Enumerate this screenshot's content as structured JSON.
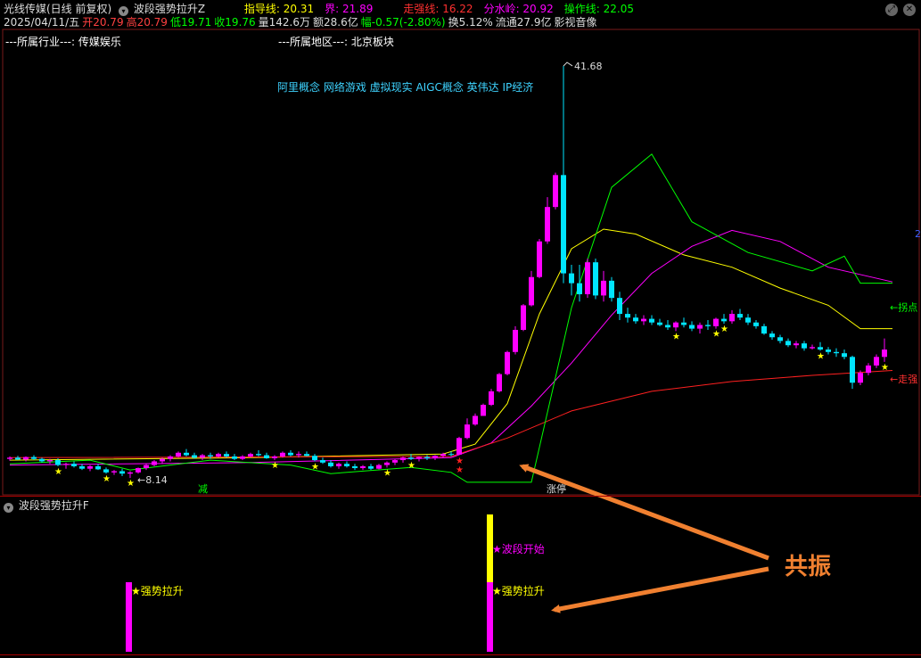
{
  "header": {
    "stock_name": "光线传媒(日线 前复权)",
    "indicator_name": "波段强势拉升Z",
    "params": [
      {
        "label": "指导线: 20.31",
        "color": "#ffff00"
      },
      {
        "label": "界: 21.89",
        "color": "#ff00ff"
      },
      {
        "label": "走强线: 16.22",
        "color": "#ff3030"
      },
      {
        "label": "分水岭: 20.92",
        "color": "#ff00ff"
      },
      {
        "label": "操作线: 22.05",
        "color": "#00ff00"
      }
    ],
    "quote": [
      {
        "label": "2025/04/11/五",
        "color": "#dddddd"
      },
      {
        "label": "开20.79",
        "color": "#ff4040"
      },
      {
        "label": "高20.79",
        "color": "#ff4040"
      },
      {
        "label": "低19.71",
        "color": "#00ff00"
      },
      {
        "label": "收19.76",
        "color": "#00ff00"
      },
      {
        "label": "量142.6万",
        "color": "#dddddd"
      },
      {
        "label": "额28.6亿",
        "color": "#dddddd"
      },
      {
        "label": "幅-0.57(-2.80%)",
        "color": "#00ff00"
      },
      {
        "label": "换5.12%",
        "color": "#dddddd"
      },
      {
        "label": "流通27.9亿",
        "color": "#dddddd"
      },
      {
        "label": "影视音像",
        "color": "#dddddd"
      }
    ]
  },
  "info": {
    "industry": "---所属行业---: 传媒娱乐",
    "region": "---所属地区---: 北京板块",
    "concepts": "阿里概念 网络游戏 虚拟现实 AIGC概念 英伟达 IP经济"
  },
  "sub_panel": {
    "title": "波段强势拉升F"
  },
  "annotation": {
    "resonance": "共振"
  },
  "colors": {
    "bull_candle": "#ff00ff",
    "bear_candle": "#00e5ff",
    "guide_line": "#ffff00",
    "watershed_line": "#ff00ff",
    "strong_line": "#ff2020",
    "operation_line": "#00ff00",
    "arrow": "#f08030"
  },
  "chart_data": [
    {
      "type": "candlestick",
      "title": "光线传媒(日线 前复权)",
      "price_range": [
        7.5,
        44.0
      ],
      "annotations": {
        "high_label": "41.68",
        "low_label": "8.14",
        "right_labels": [
          "←拐点",
          "←走强"
        ],
        "bottom_marks": [
          "减",
          "涨停"
        ],
        "side_number": "2"
      },
      "candles_ohlc": [
        [
          9.7,
          9.9,
          9.55,
          9.8
        ],
        [
          9.8,
          9.95,
          9.6,
          9.65
        ],
        [
          9.65,
          9.9,
          9.5,
          9.85
        ],
        [
          9.85,
          10.0,
          9.6,
          9.7
        ],
        [
          9.7,
          9.8,
          9.4,
          9.5
        ],
        [
          9.5,
          9.7,
          9.3,
          9.6
        ],
        [
          9.6,
          9.75,
          9.1,
          9.2
        ],
        [
          9.2,
          9.4,
          8.9,
          9.3
        ],
        [
          9.3,
          9.5,
          9.0,
          9.1
        ],
        [
          9.1,
          9.3,
          8.8,
          8.9
        ],
        [
          8.9,
          9.2,
          8.7,
          9.1
        ],
        [
          9.1,
          9.3,
          8.8,
          8.85
        ],
        [
          8.85,
          9.0,
          8.5,
          8.6
        ],
        [
          8.6,
          8.8,
          8.4,
          8.7
        ],
        [
          8.7,
          8.9,
          8.3,
          8.5
        ],
        [
          8.5,
          8.7,
          8.14,
          8.6
        ],
        [
          8.6,
          9.0,
          8.5,
          8.95
        ],
        [
          8.95,
          9.3,
          8.8,
          9.2
        ],
        [
          9.2,
          9.6,
          9.1,
          9.5
        ],
        [
          9.5,
          9.8,
          9.3,
          9.7
        ],
        [
          9.7,
          10.0,
          9.5,
          9.9
        ],
        [
          9.9,
          10.3,
          9.8,
          10.2
        ],
        [
          10.2,
          10.5,
          9.9,
          10.0
        ],
        [
          10.0,
          10.2,
          9.7,
          9.8
        ],
        [
          9.8,
          10.1,
          9.6,
          10.0
        ],
        [
          10.0,
          10.2,
          9.7,
          9.9
        ],
        [
          9.9,
          10.2,
          9.8,
          10.1
        ],
        [
          10.1,
          10.3,
          9.8,
          9.9
        ],
        [
          9.9,
          10.1,
          9.6,
          9.7
        ],
        [
          9.7,
          10.0,
          9.6,
          9.9
        ],
        [
          9.9,
          10.2,
          9.8,
          10.1
        ],
        [
          10.1,
          10.4,
          9.9,
          10.0
        ],
        [
          10.0,
          10.2,
          9.7,
          9.75
        ],
        [
          9.75,
          10.0,
          9.6,
          9.9
        ],
        [
          9.9,
          10.3,
          9.8,
          10.2
        ],
        [
          10.2,
          10.4,
          9.9,
          10.0
        ],
        [
          10.0,
          10.3,
          9.8,
          10.1
        ],
        [
          10.1,
          10.3,
          9.9,
          9.95
        ],
        [
          9.95,
          10.1,
          9.5,
          9.6
        ],
        [
          9.6,
          9.8,
          9.3,
          9.4
        ],
        [
          9.4,
          9.6,
          9.0,
          9.1
        ],
        [
          9.1,
          9.4,
          8.9,
          9.3
        ],
        [
          9.3,
          9.5,
          9.0,
          9.1
        ],
        [
          9.1,
          9.3,
          8.8,
          8.95
        ],
        [
          8.95,
          9.2,
          8.8,
          9.1
        ],
        [
          9.1,
          9.3,
          8.8,
          8.9
        ],
        [
          8.9,
          9.3,
          8.85,
          9.2
        ],
        [
          9.2,
          9.5,
          9.0,
          9.4
        ],
        [
          9.4,
          9.7,
          9.2,
          9.6
        ],
        [
          9.6,
          9.9,
          9.4,
          9.8
        ],
        [
          9.8,
          10.1,
          9.6,
          9.7
        ],
        [
          9.7,
          9.9,
          9.5,
          9.85
        ],
        [
          9.85,
          10.0,
          9.6,
          9.75
        ],
        [
          9.75,
          10.0,
          9.6,
          9.95
        ],
        [
          9.95,
          10.2,
          9.8,
          10.1
        ],
        [
          10.1,
          10.3,
          9.9,
          10.05
        ],
        [
          10.05,
          11.5,
          10.0,
          11.4
        ],
        [
          11.4,
          13.0,
          11.3,
          12.5
        ],
        [
          12.5,
          13.4,
          12.4,
          13.2
        ],
        [
          13.2,
          14.2,
          13.2,
          14.1
        ],
        [
          14.1,
          15.4,
          14.0,
          15.2
        ],
        [
          15.2,
          16.7,
          15.1,
          16.6
        ],
        [
          16.6,
          18.5,
          16.5,
          18.4
        ],
        [
          18.4,
          20.5,
          18.2,
          20.2
        ],
        [
          20.2,
          22.3,
          20.1,
          22.2
        ],
        [
          22.2,
          25.0,
          22.1,
          24.5
        ],
        [
          24.5,
          27.6,
          24.4,
          27.4
        ],
        [
          27.4,
          31.0,
          27.2,
          30.2
        ],
        [
          30.2,
          33.0,
          30.0,
          32.8
        ],
        [
          32.8,
          41.68,
          24.0,
          24.8
        ],
        [
          24.8,
          25.5,
          23.0,
          24.0
        ],
        [
          24.0,
          25.5,
          22.5,
          23.1
        ],
        [
          23.1,
          26.0,
          22.8,
          25.7
        ],
        [
          25.7,
          26.0,
          22.7,
          23.0
        ],
        [
          23.0,
          25.0,
          22.5,
          24.2
        ],
        [
          24.2,
          24.5,
          22.5,
          22.8
        ],
        [
          22.8,
          23.3,
          21.0,
          21.5
        ],
        [
          21.5,
          22.0,
          20.8,
          21.2
        ],
        [
          21.2,
          21.5,
          20.7,
          20.9
        ],
        [
          20.9,
          21.4,
          20.6,
          21.1
        ],
        [
          21.1,
          21.4,
          20.6,
          20.8
        ],
        [
          20.8,
          21.1,
          20.5,
          20.6
        ],
        [
          20.6,
          21.0,
          20.2,
          20.4
        ],
        [
          20.4,
          20.9,
          20.1,
          20.8
        ],
        [
          20.8,
          21.2,
          20.4,
          20.6
        ],
        [
          20.6,
          20.9,
          20.1,
          20.3
        ],
        [
          20.3,
          20.8,
          19.9,
          20.6
        ],
        [
          20.6,
          21.0,
          20.2,
          20.5
        ],
        [
          20.5,
          21.2,
          20.3,
          21.1
        ],
        [
          21.1,
          21.5,
          20.7,
          20.9
        ],
        [
          20.9,
          21.8,
          20.7,
          21.5
        ],
        [
          21.5,
          21.9,
          21.0,
          21.2
        ],
        [
          21.2,
          21.5,
          20.6,
          20.8
        ],
        [
          20.8,
          21.0,
          20.3,
          20.5
        ],
        [
          20.5,
          20.7,
          19.8,
          19.9
        ],
        [
          19.9,
          20.1,
          19.4,
          19.6
        ],
        [
          19.6,
          19.8,
          19.1,
          19.3
        ],
        [
          19.3,
          19.5,
          18.8,
          18.95
        ],
        [
          18.95,
          19.3,
          18.7,
          19.1
        ],
        [
          19.1,
          19.3,
          18.5,
          18.7
        ],
        [
          18.7,
          19.0,
          18.6,
          18.8
        ],
        [
          18.8,
          19.2,
          18.5,
          18.6
        ],
        [
          18.6,
          18.8,
          18.2,
          18.4
        ],
        [
          18.4,
          18.7,
          18.0,
          18.3
        ],
        [
          18.3,
          18.6,
          17.8,
          18.0
        ],
        [
          18.0,
          18.1,
          15.4,
          15.9
        ],
        [
          15.9,
          16.9,
          15.7,
          16.7
        ],
        [
          16.7,
          17.5,
          16.5,
          17.3
        ],
        [
          17.3,
          18.2,
          17.1,
          18.0
        ],
        [
          18.0,
          19.5,
          17.6,
          18.6
        ]
      ],
      "series": [
        {
          "name": "指导线",
          "values_sparse": [
            [
              0,
              9.6
            ],
            [
              30,
              9.8
            ],
            [
              54,
              10.1
            ],
            [
              58,
              10.9
            ],
            [
              62,
              14.2
            ],
            [
              66,
              21.5
            ],
            [
              70,
              26.8
            ],
            [
              74,
              28.4
            ],
            [
              78,
              28.0
            ],
            [
              84,
              26.3
            ],
            [
              90,
              25.3
            ],
            [
              96,
              23.6
            ],
            [
              102,
              22.2
            ],
            [
              106,
              20.3
            ],
            [
              110,
              20.3
            ]
          ]
        },
        {
          "name": "分水岭",
          "values_sparse": [
            [
              0,
              9.2
            ],
            [
              30,
              9.4
            ],
            [
              55,
              9.8
            ],
            [
              60,
              11.0
            ],
            [
              65,
              14.0
            ],
            [
              70,
              17.5
            ],
            [
              75,
              21.4
            ],
            [
              80,
              24.8
            ],
            [
              85,
              27.0
            ],
            [
              90,
              28.3
            ],
            [
              96,
              27.4
            ],
            [
              102,
              25.3
            ],
            [
              110,
              24.1
            ]
          ]
        },
        {
          "name": "走强线",
          "values_sparse": [
            [
              0,
              9.8
            ],
            [
              55,
              9.9
            ],
            [
              62,
              11.4
            ],
            [
              70,
              13.6
            ],
            [
              80,
              15.2
            ],
            [
              90,
              16.0
            ],
            [
              100,
              16.5
            ],
            [
              110,
              16.9
            ]
          ]
        },
        {
          "name": "操作线",
          "values_sparse": [
            [
              0,
              9.3
            ],
            [
              10,
              9.6
            ],
            [
              15,
              8.8
            ],
            [
              25,
              9.6
            ],
            [
              35,
              9.2
            ],
            [
              40,
              8.5
            ],
            [
              50,
              9.0
            ],
            [
              55,
              8.6
            ],
            [
              57,
              7.8
            ],
            [
              65,
              7.8
            ],
            [
              70,
              22.0
            ],
            [
              75,
              31.8
            ],
            [
              80,
              34.5
            ],
            [
              85,
              29.0
            ],
            [
              92,
              26.5
            ],
            [
              100,
              25.0
            ],
            [
              104,
              26.2
            ],
            [
              106,
              24.0
            ],
            [
              110,
              24.0
            ]
          ]
        }
      ]
    },
    {
      "type": "bar",
      "title": "波段强势拉升F",
      "signals": [
        {
          "index": 15,
          "label": "强势拉升",
          "color": "#ff00ff",
          "value": 1
        },
        {
          "index": 60,
          "label": "强势拉升",
          "color": "#ff00ff",
          "value": 1
        },
        {
          "index": 60,
          "label": "波段开始",
          "color": "#ffff00",
          "value": 1
        }
      ]
    }
  ]
}
